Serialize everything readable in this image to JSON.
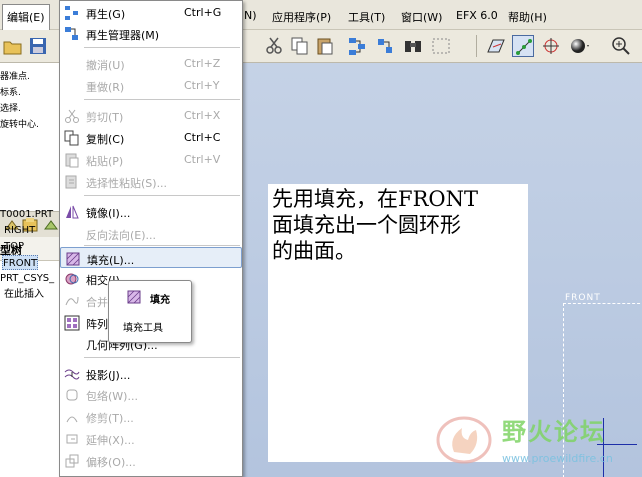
{
  "menubar": {
    "edit": "编辑(E)",
    "view": "N)",
    "apps": "应用程序(P)",
    "tools": "工具(T)",
    "window": "窗口(W)",
    "efx": "EFX 6.0",
    "help": "帮助(H)"
  },
  "messages": [
    "器准点.",
    "标系.",
    "选择.",
    "旋转中心."
  ],
  "tree": {
    "header": "型树",
    "items": [
      "T0001.PRT",
      "RIGHT",
      "TOP",
      "FRONT",
      "PRT_CSYS_",
      "在此插入"
    ]
  },
  "edit_menu": {
    "regenerate": {
      "label": "再生(G)",
      "shortcut": "Ctrl+G"
    },
    "regen_manager": {
      "label": "再生管理器(M)"
    },
    "undo": {
      "label": "撤消(U)",
      "shortcut": "Ctrl+Z"
    },
    "redo": {
      "label": "重做(R)",
      "shortcut": "Ctrl+Y"
    },
    "cut": {
      "label": "剪切(T)",
      "shortcut": "Ctrl+X"
    },
    "copy": {
      "label": "复制(C)",
      "shortcut": "Ctrl+C"
    },
    "paste": {
      "label": "粘贴(P)",
      "shortcut": "Ctrl+V"
    },
    "paste_special": {
      "label": "选择性粘贴(S)..."
    },
    "mirror": {
      "label": "镜像(I)..."
    },
    "reverse_normal": {
      "label": "反向法向(E)..."
    },
    "fill": {
      "label": "填充(L)..."
    },
    "intersect": {
      "label": "相交(I)..."
    },
    "merge": {
      "label": "合并"
    },
    "pattern": {
      "label": "阵列"
    },
    "geom_pattern": {
      "label": "几何阵列(G)..."
    },
    "project": {
      "label": "投影(J)..."
    },
    "wrap": {
      "label": "包络(W)..."
    },
    "trim": {
      "label": "修剪(T)..."
    },
    "extend": {
      "label": "延伸(X)..."
    },
    "offset": {
      "label": "偏移(O)..."
    }
  },
  "tooltip": {
    "title": "填充",
    "desc": "填充工具"
  },
  "note": {
    "line1": "先用填充，在FRONT",
    "line2": "面填充出一个圆环形",
    "line3": "的曲面。"
  },
  "graphics": {
    "plane_label": "FRONT"
  },
  "watermark": {
    "title": "野火论坛",
    "url": "www.proewildfire.cn"
  },
  "colors": {
    "accent": "#7d9fcf",
    "menu_hover": "#e6eef8",
    "watermark_green": "#7fd466"
  }
}
